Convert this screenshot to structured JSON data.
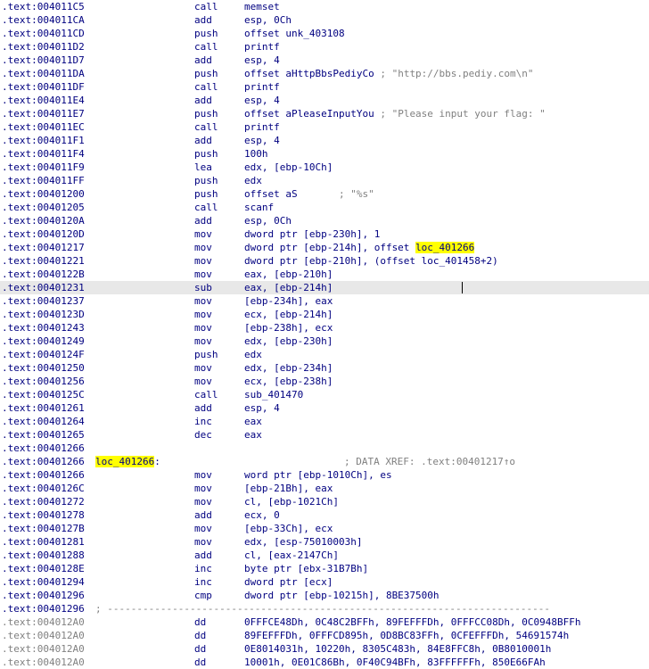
{
  "rows": [
    {
      "addr": ".text:004011C5",
      "mnem": "call",
      "op": "memset"
    },
    {
      "addr": ".text:004011CA",
      "mnem": "add",
      "op": "esp, 0Ch"
    },
    {
      "addr": ".text:004011CD",
      "mnem": "push",
      "op": "offset unk_403108"
    },
    {
      "addr": ".text:004011D2",
      "mnem": "call",
      "op": "printf"
    },
    {
      "addr": ".text:004011D7",
      "mnem": "add",
      "op": "esp, 4"
    },
    {
      "addr": ".text:004011DA",
      "mnem": "push",
      "op": "offset aHttpBbsPediyCo",
      "comment": " ; \"http://bbs.pediy.com\\n\""
    },
    {
      "addr": ".text:004011DF",
      "mnem": "call",
      "op": "printf"
    },
    {
      "addr": ".text:004011E4",
      "mnem": "add",
      "op": "esp, 4"
    },
    {
      "addr": ".text:004011E7",
      "mnem": "push",
      "op": "offset aPleaseInputYou",
      "comment": " ; \"Please input your flag: \""
    },
    {
      "addr": ".text:004011EC",
      "mnem": "call",
      "op": "printf"
    },
    {
      "addr": ".text:004011F1",
      "mnem": "add",
      "op": "esp, 4"
    },
    {
      "addr": ".text:004011F4",
      "mnem": "push",
      "op": "100h"
    },
    {
      "addr": ".text:004011F9",
      "mnem": "lea",
      "op": "edx, [ebp-10Ch]"
    },
    {
      "addr": ".text:004011FF",
      "mnem": "push",
      "op": "edx"
    },
    {
      "addr": ".text:00401200",
      "mnem": "push",
      "op": "offset aS",
      "comment": "       ; \"%s\""
    },
    {
      "addr": ".text:00401205",
      "mnem": "call",
      "op": "scanf"
    },
    {
      "addr": ".text:0040120A",
      "mnem": "add",
      "op": "esp, 0Ch"
    },
    {
      "addr": ".text:0040120D",
      "mnem": "mov",
      "op": "dword ptr [ebp-230h], 1"
    },
    {
      "addr": ".text:00401217",
      "mnem": "mov",
      "op": "dword ptr [ebp-214h], offset ",
      "op_hl": "loc_401266"
    },
    {
      "addr": ".text:00401221",
      "mnem": "mov",
      "op": "dword ptr [ebp-210h], (offset loc_401458+2)"
    },
    {
      "addr": ".text:0040122B",
      "mnem": "mov",
      "op": "eax, [ebp-210h]"
    },
    {
      "addr": ".text:00401231",
      "mnem": "sub",
      "op": "eax, [ebp-214h]",
      "highlight": true
    },
    {
      "addr": ".text:00401237",
      "mnem": "mov",
      "op": "[ebp-234h], eax"
    },
    {
      "addr": ".text:0040123D",
      "mnem": "mov",
      "op": "ecx, [ebp-214h]"
    },
    {
      "addr": ".text:00401243",
      "mnem": "mov",
      "op": "[ebp-238h], ecx"
    },
    {
      "addr": ".text:00401249",
      "mnem": "mov",
      "op": "edx, [ebp-230h]"
    },
    {
      "addr": ".text:0040124F",
      "mnem": "push",
      "op": "edx"
    },
    {
      "addr": ".text:00401250",
      "mnem": "mov",
      "op": "edx, [ebp-234h]"
    },
    {
      "addr": ".text:00401256",
      "mnem": "mov",
      "op": "ecx, [ebp-238h]"
    },
    {
      "addr": ".text:0040125C",
      "mnem": "call",
      "op": "sub_401470"
    },
    {
      "addr": ".text:00401261",
      "mnem": "add",
      "op": "esp, 4"
    },
    {
      "addr": ".text:00401264",
      "mnem": "inc",
      "op": "eax"
    },
    {
      "addr": ".text:00401265",
      "mnem": "dec",
      "op": "eax"
    },
    {
      "addr": ".text:00401266",
      "mnem": "",
      "op": ""
    },
    {
      "addr": ".text:00401266",
      "label": "loc_401266",
      "label_suffix": ":",
      "xref": "; DATA XREF: .text:00401217↑o"
    },
    {
      "addr": ".text:00401266",
      "mnem": "mov",
      "op": "word ptr [ebp-1010Ch], es"
    },
    {
      "addr": ".text:0040126C",
      "mnem": "mov",
      "op": "[ebp-21Bh], eax"
    },
    {
      "addr": ".text:00401272",
      "mnem": "mov",
      "op": "cl, [ebp-1021Ch]"
    },
    {
      "addr": ".text:00401278",
      "mnem": "add",
      "op": "ecx, 0"
    },
    {
      "addr": ".text:0040127B",
      "mnem": "mov",
      "op": "[ebp-33Ch], ecx"
    },
    {
      "addr": ".text:00401281",
      "mnem": "mov",
      "op": "edx, [esp-75010003h]"
    },
    {
      "addr": ".text:00401288",
      "mnem": "add",
      "op": "cl, [eax-2147Ch]"
    },
    {
      "addr": ".text:0040128E",
      "mnem": "inc",
      "op": "byte ptr [ebx-31B7Bh]"
    },
    {
      "addr": ".text:00401294",
      "mnem": "inc",
      "op": "dword ptr [ecx]"
    },
    {
      "addr": ".text:00401296",
      "mnem": "cmp",
      "op": "dword ptr [ebp-10215h], 8BE37500h"
    },
    {
      "addr": ".text:00401296",
      "separator": "; ---------------------------------------------------------------------------"
    },
    {
      "addr": ".text:004012A0",
      "gray": true,
      "mnem": "dd",
      "op": "0FFFCE48Dh, 0C48C2BFFh, 89FEFFFDh, 0FFFCC08Dh, 0C0948BFFh"
    },
    {
      "addr": ".text:004012A0",
      "gray": true,
      "mnem": "dd",
      "op": "89FEFFFDh, 0FFFCD895h, 0D8BC83FFh, 0CFEFFFDh, 54691574h"
    },
    {
      "addr": ".text:004012A0",
      "gray": true,
      "mnem": "dd",
      "op": "0E8014031h, 10220h, 8305C483h, 84E8FFC8h, 0B8010001h"
    },
    {
      "addr": ".text:004012A0",
      "gray": true,
      "mnem": "dd",
      "op": "10001h, 0E01C86Bh, 0F40C94BFh, 83FFFFFFh, 850E66FAh"
    }
  ]
}
